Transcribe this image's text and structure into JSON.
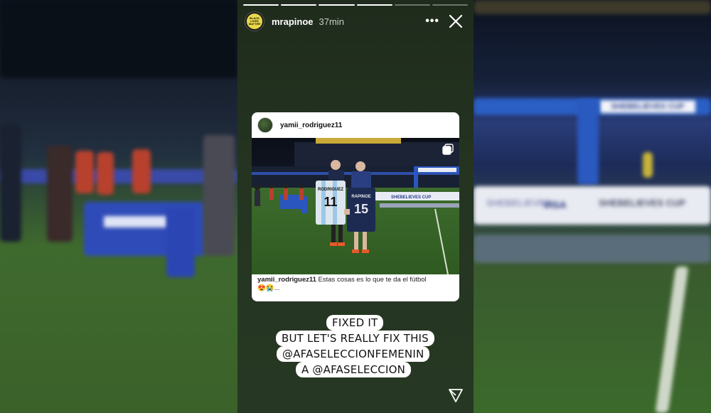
{
  "story": {
    "username": "mrapinoe",
    "time": "37min",
    "avatar_text": "BLACK LIVES MATTER",
    "progress_segments": 6,
    "progress_done": 4
  },
  "post": {
    "username": "yamii_rodriguez11",
    "caption_user": "yamii_rodriguez11",
    "caption_text": "Estas cosas es lo que te da el fútbol",
    "caption_emoji": "😍😭...",
    "jersey_left_name": "RODRIGUEZ",
    "jersey_left_number": "11",
    "jersey_right_name": "RAPINOE",
    "jersey_right_number": "15",
    "board_text": "SHEBELIEVES CUP",
    "sponsor_text": "VISA"
  },
  "stickers": {
    "line1": "FIXED IT",
    "line2": "BUT LET'S REALLY FIX THIS",
    "line3": "@AFASELECCIONFEMENIN",
    "line4": "A  @AFASELECCION"
  },
  "background": {
    "board_right_text": "SHEBELIEVES CUP",
    "board_right_sponsor": "VISA",
    "board_left_text": "SHEBELIEVES",
    "board_left_sponsor": "VISA"
  },
  "icons": {
    "more": "more-icon",
    "close": "close-icon",
    "send": "send-icon",
    "carousel": "carousel-icon"
  },
  "colors": {
    "story_bg": "#243421",
    "card_bg": "#ffffff",
    "sticker_bg": "#ffffff",
    "sticker_text": "#111111"
  }
}
